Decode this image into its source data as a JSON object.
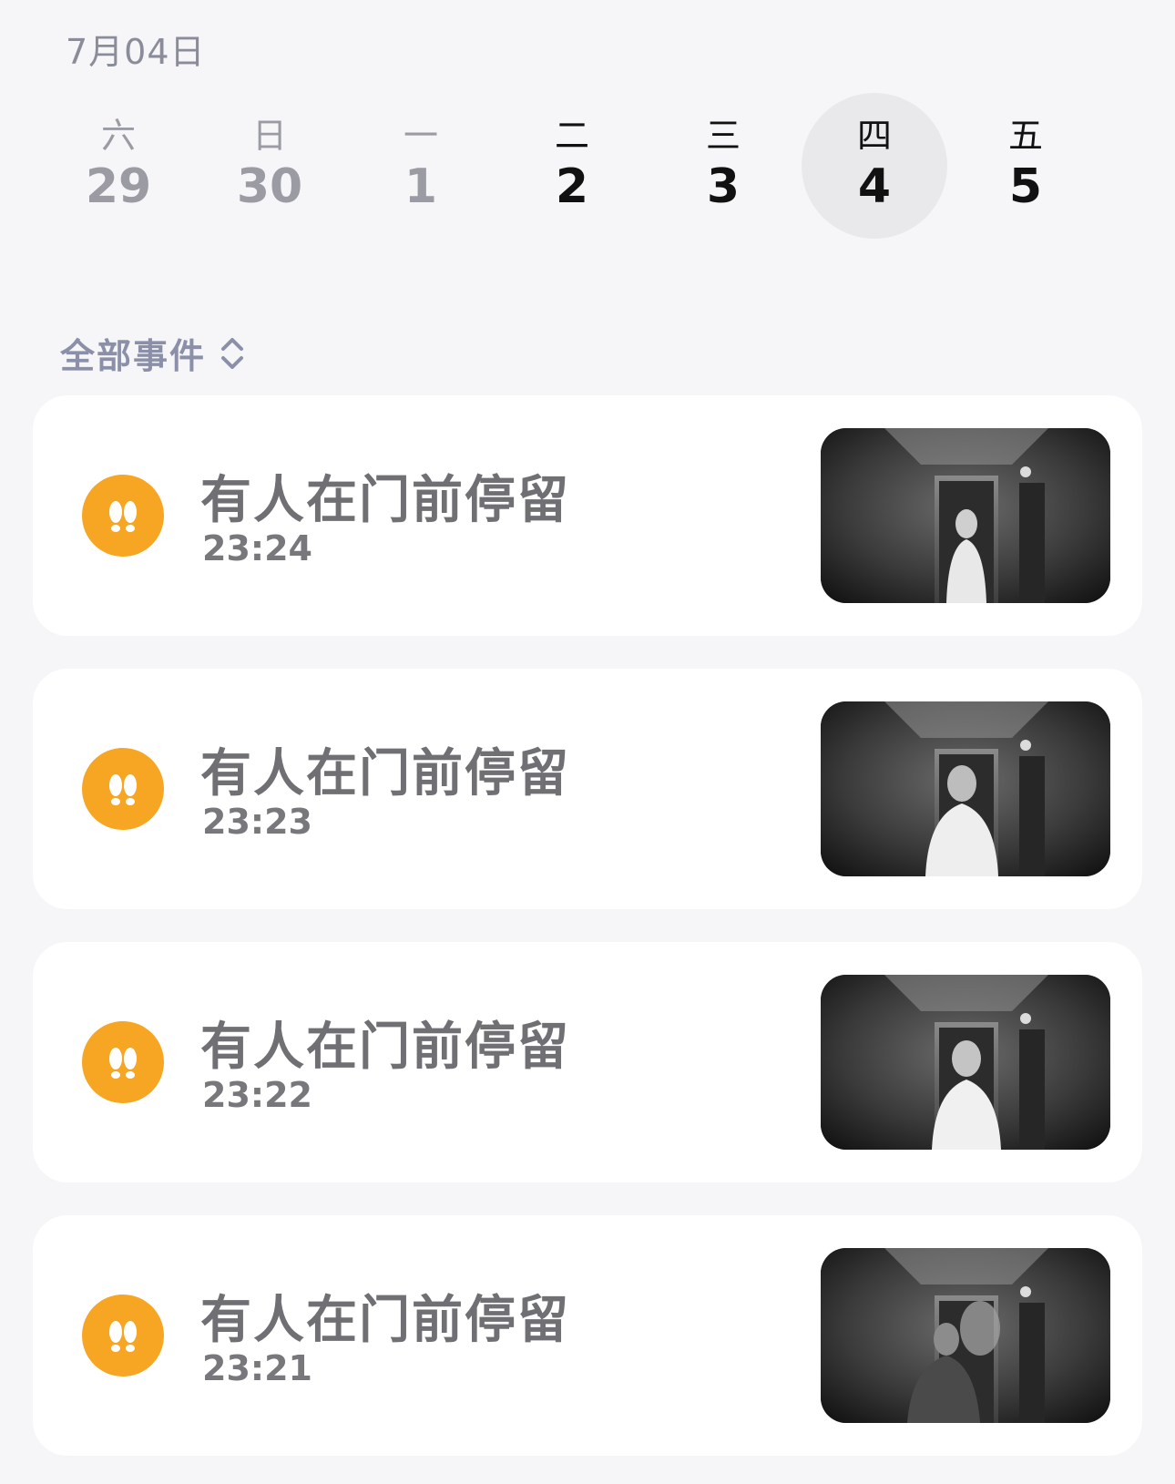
{
  "header": {
    "date": "7月04日"
  },
  "week": [
    {
      "weekday": "六",
      "day": "29",
      "state": "past"
    },
    {
      "weekday": "日",
      "day": "30",
      "state": "past"
    },
    {
      "weekday": "一",
      "day": "1",
      "state": "past"
    },
    {
      "weekday": "二",
      "day": "2",
      "state": "current"
    },
    {
      "weekday": "三",
      "day": "3",
      "state": "current"
    },
    {
      "weekday": "四",
      "day": "4",
      "state": "selected"
    },
    {
      "weekday": "五",
      "day": "5",
      "state": "current"
    }
  ],
  "filter": {
    "label": "全部事件",
    "icon": "up-down-chevron-icon"
  },
  "events": [
    {
      "title": "有人在门前停留",
      "time": "23:24",
      "icon": "footprints-icon",
      "thumbnail": "hallway-camera-snapshot"
    },
    {
      "title": "有人在门前停留",
      "time": "23:23",
      "icon": "footprints-icon",
      "thumbnail": "hallway-camera-snapshot"
    },
    {
      "title": "有人在门前停留",
      "time": "23:22",
      "icon": "footprints-icon",
      "thumbnail": "hallway-camera-snapshot"
    },
    {
      "title": "有人在门前停留",
      "time": "23:21",
      "icon": "footprints-icon",
      "thumbnail": "hallway-camera-snapshot"
    }
  ],
  "colors": {
    "badge": "#f6a623",
    "background": "#f6f6f8",
    "card": "#ffffff"
  }
}
